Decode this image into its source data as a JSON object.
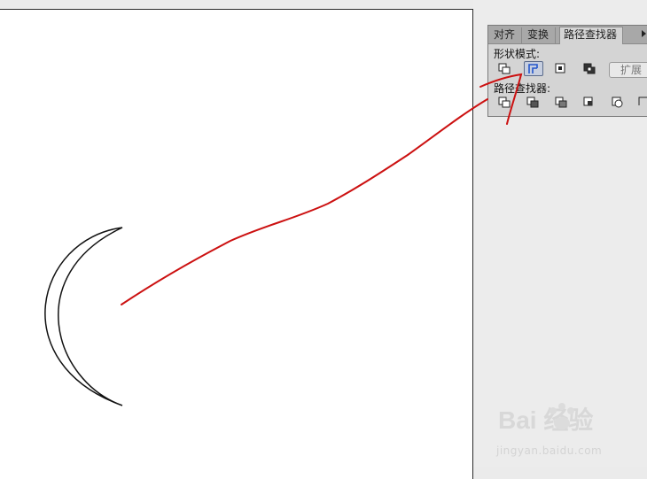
{
  "panel": {
    "tabs": [
      {
        "label": "对齐",
        "active": false
      },
      {
        "label": "变换",
        "active": false
      },
      {
        "label": "路径查找器",
        "active": true
      }
    ],
    "shape_modes_label": "形状模式:",
    "pathfinders_label": "路径查找器:",
    "expand_label": "扩展",
    "shape_mode_buttons": [
      "unite-icon",
      "minus-front-icon",
      "intersect-icon",
      "exclude-icon"
    ],
    "selected_shape_mode": "minus-front-icon",
    "pathfinder_buttons": [
      "divide-icon",
      "trim-icon",
      "merge-icon",
      "crop-icon",
      "outline-icon",
      "minus-back-icon"
    ]
  },
  "watermark": {
    "brand": "Bai 经验",
    "url": "jingyan.baidu.com"
  },
  "colors": {
    "annotation": "#cc1111",
    "artboard": "#ffffff",
    "panel": "#d4d4d4",
    "selected": "#2255cc"
  }
}
